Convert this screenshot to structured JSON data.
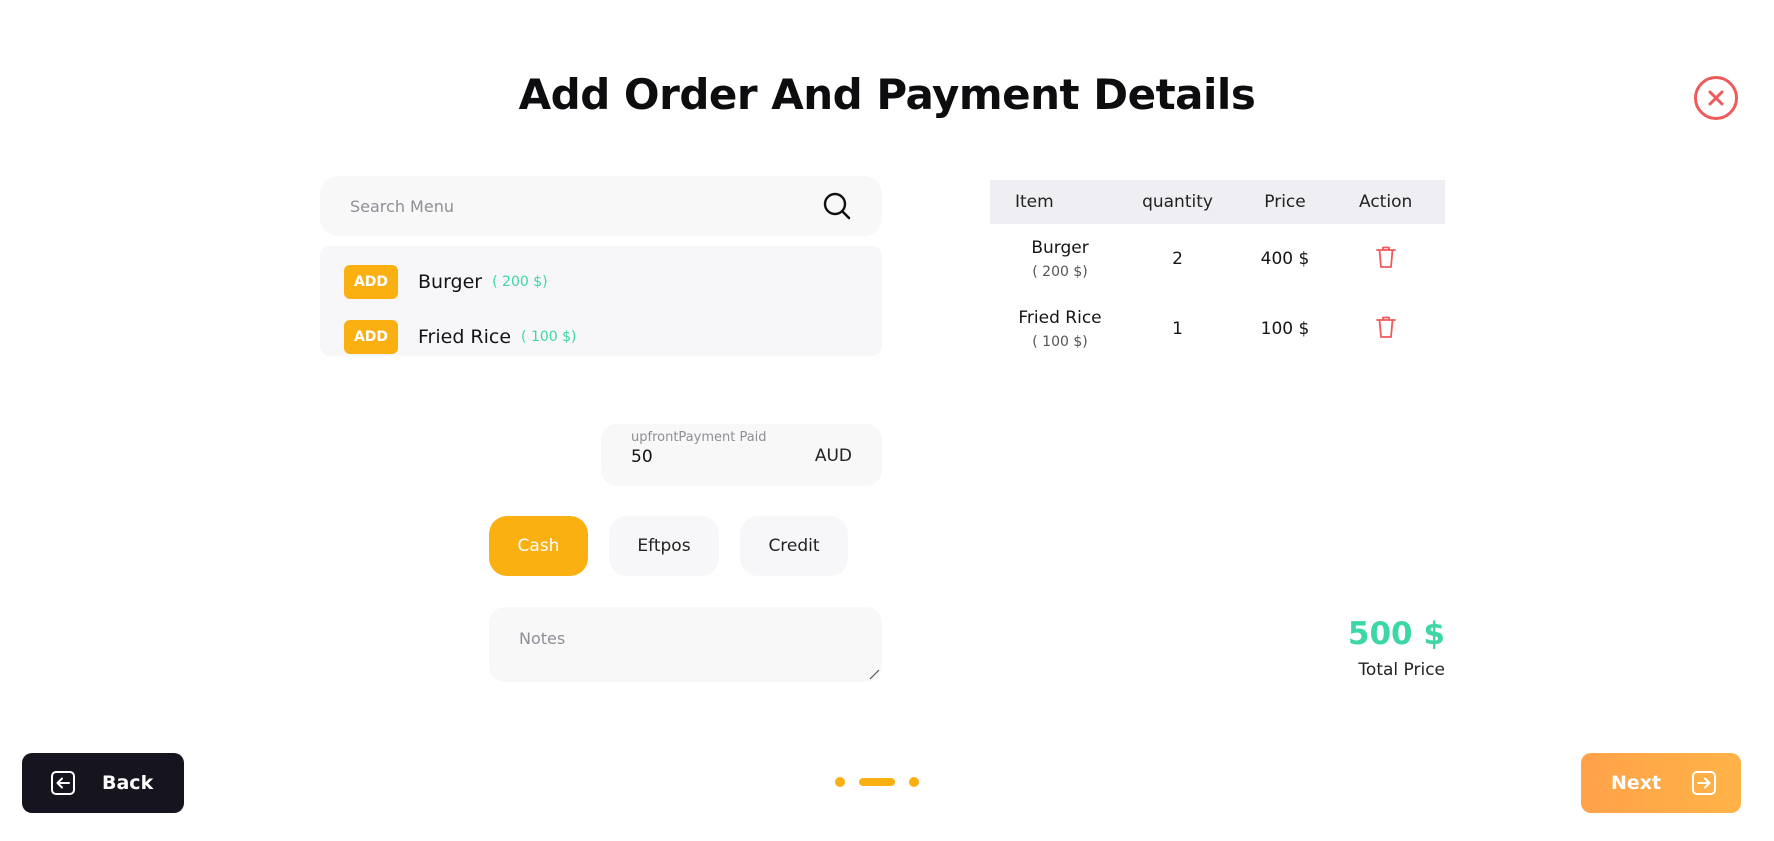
{
  "page": {
    "title": "Add Order And Payment Details"
  },
  "search": {
    "placeholder": "Search Menu",
    "value": ""
  },
  "menu": {
    "add_label": "ADD",
    "items": [
      {
        "name": "Burger",
        "price": "( 200 $)"
      },
      {
        "name": "Fried Rice",
        "price": "( 100 $)"
      }
    ]
  },
  "upfront": {
    "label": "upfrontPayment Paid",
    "value": "50",
    "currency": "AUD"
  },
  "payment_methods": {
    "cash": "Cash",
    "eftpos": "Eftpos",
    "credit": "Credit",
    "selected": "Cash"
  },
  "notes": {
    "placeholder": "Notes",
    "value": ""
  },
  "order_table": {
    "headers": {
      "item": "Item",
      "quantity": "quantity",
      "price": "Price",
      "action": "Action"
    },
    "rows": [
      {
        "item": "Burger",
        "unit_price": "( 200 $)",
        "quantity": "2",
        "price": "400 $"
      },
      {
        "item": "Fried Rice",
        "unit_price": "( 100 $)",
        "quantity": "1",
        "price": "100 $"
      }
    ]
  },
  "total": {
    "amount": "500 $",
    "label": "Total Price"
  },
  "footer": {
    "back_label": "Back",
    "next_label": "Next",
    "step_current": 2,
    "step_total": 3
  },
  "colors": {
    "accent": "#fbb012",
    "success": "#3dd6a6",
    "danger": "#ef5a5a",
    "dark": "#16151f",
    "next_gradient": [
      "#ffa24a",
      "#ffb347"
    ]
  },
  "icons": {
    "close": "close-icon",
    "search": "search-icon",
    "delete": "trash-icon",
    "back": "arrow-left-square-icon",
    "next": "arrow-right-square-icon"
  }
}
